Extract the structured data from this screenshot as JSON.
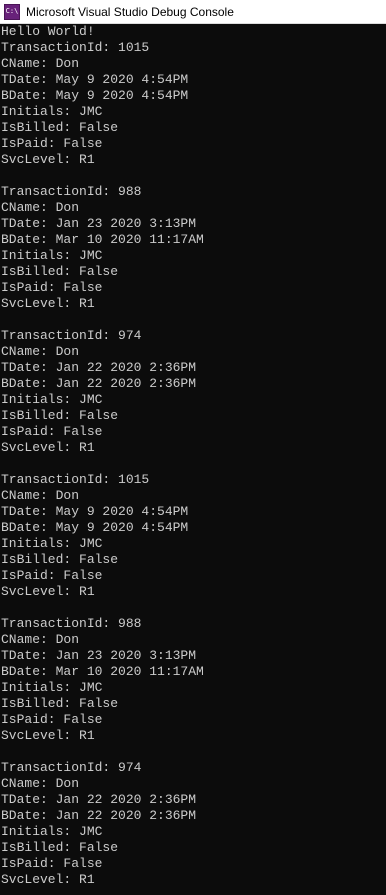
{
  "window": {
    "title": "Microsoft Visual Studio Debug Console",
    "icon": "visual-studio-console-icon",
    "icon_text": "C:\\"
  },
  "console": {
    "lines": [
      "Hello World!",
      "TransactionId: 1015",
      "CName: Don",
      "TDate: May 9 2020 4:54PM",
      "BDate: May 9 2020 4:54PM",
      "Initials: JMC",
      "IsBilled: False",
      "IsPaid: False",
      "SvcLevel: R1",
      "",
      "TransactionId: 988",
      "CName: Don",
      "TDate: Jan 23 2020 3:13PM",
      "BDate: Mar 10 2020 11:17AM",
      "Initials: JMC",
      "IsBilled: False",
      "IsPaid: False",
      "SvcLevel: R1",
      "",
      "TransactionId: 974",
      "CName: Don",
      "TDate: Jan 22 2020 2:36PM",
      "BDate: Jan 22 2020 2:36PM",
      "Initials: JMC",
      "IsBilled: False",
      "IsPaid: False",
      "SvcLevel: R1",
      "",
      "TransactionId: 1015",
      "CName: Don",
      "TDate: May 9 2020 4:54PM",
      "BDate: May 9 2020 4:54PM",
      "Initials: JMC",
      "IsBilled: False",
      "IsPaid: False",
      "SvcLevel: R1",
      "",
      "TransactionId: 988",
      "CName: Don",
      "TDate: Jan 23 2020 3:13PM",
      "BDate: Mar 10 2020 11:17AM",
      "Initials: JMC",
      "IsBilled: False",
      "IsPaid: False",
      "SvcLevel: R1",
      "",
      "TransactionId: 974",
      "CName: Don",
      "TDate: Jan 22 2020 2:36PM",
      "BDate: Jan 22 2020 2:36PM",
      "Initials: JMC",
      "IsBilled: False",
      "IsPaid: False",
      "SvcLevel: R1"
    ]
  },
  "colors": {
    "background": "#0c0c0c",
    "text": "#cccccc",
    "titlebar": "#ffffff"
  }
}
